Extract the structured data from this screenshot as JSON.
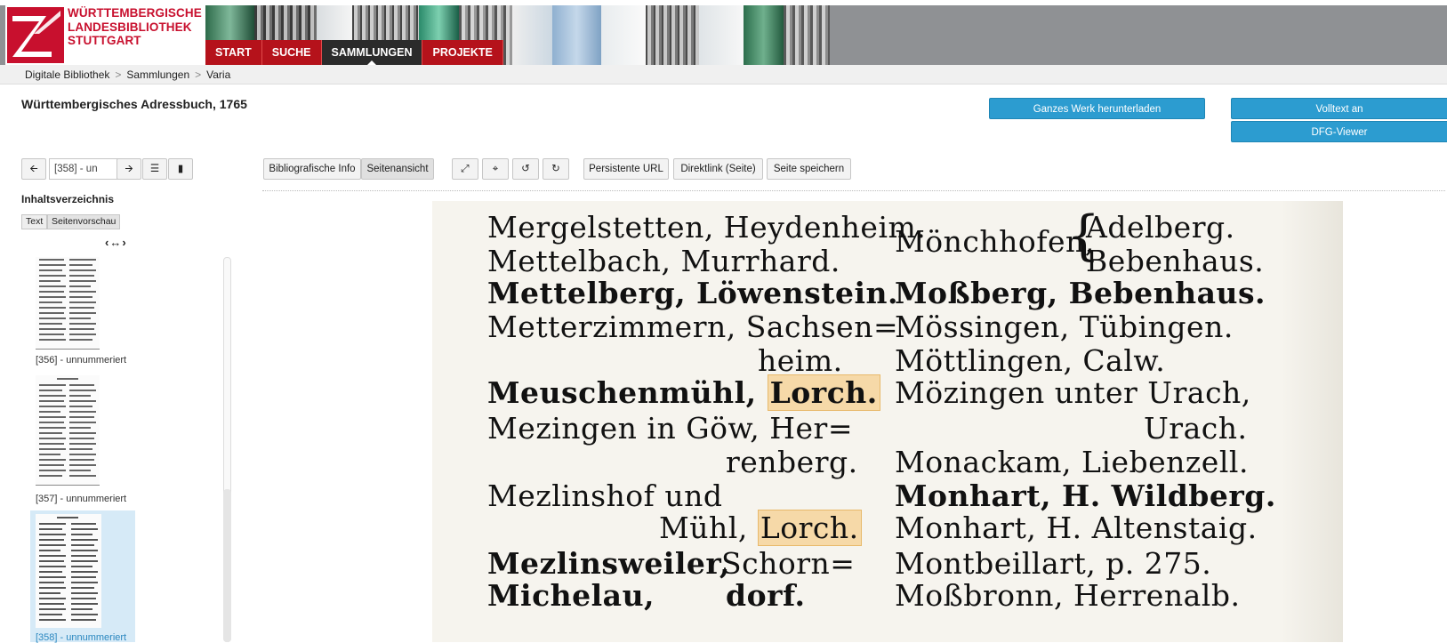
{
  "logo": {
    "line1": "WÜRTTEMBERGISCHE",
    "line2": "LANDESBIBLIOTHEK",
    "line3": "STUTTGART"
  },
  "nav": [
    "START",
    "SUCHE",
    "SAMMLUNGEN",
    "PROJEKTE"
  ],
  "breadcrumb": [
    "Digitale Bibliothek",
    "Sammlungen",
    "Varia"
  ],
  "breadcrumb_sep": ">",
  "title": "Württembergisches Adressbuch, 1765",
  "actions": {
    "download": "Ganzes Werk herunterladen",
    "fulltext": "Volltext an",
    "dfg": "DFG-Viewer"
  },
  "pager": {
    "prev_icon": "arrow-left-icon",
    "page_value": "[358] - un",
    "next_icon": "arrow-right-icon",
    "list_icon": "list-icon",
    "book_icon": "book-icon"
  },
  "view_tabs": [
    "Bibliografische Info",
    "Seitenansicht"
  ],
  "view_tools": [
    "fullscreen-icon",
    "fit-icon",
    "rotate-left-icon",
    "rotate-right-icon"
  ],
  "links": [
    "Persistente URL",
    "Direktlink (Seite)",
    "Seite speichern"
  ],
  "toc": {
    "label": "Inhaltsverzeichnis",
    "tab_text": "Text",
    "tab_preview": "Seitenvorschau",
    "resize": "‹↔›",
    "items": [
      {
        "caption": "[356] - unnummeriert"
      },
      {
        "caption": "[357] - unnummeriert"
      },
      {
        "caption": "[358] - unnummeriert"
      }
    ]
  },
  "page_text": {
    "left": [
      "Mergelstetten, Heydenheim.",
      "Mettelbach, Murrhard.",
      "Mettelberg, Löwenstein.",
      "Metterzimmern, Sachsen=",
      "heim.",
      "Meuschenmühl, ",
      "Lorch.",
      "Mezingen in Göw, Her=",
      "renberg.",
      "Mezlinshof und",
      "Mühl, ",
      "Lorch.",
      "Mezlinsweiler,",
      "Schorn=",
      "Michelau,",
      "dorf."
    ],
    "right": [
      "Mönchhofen,",
      "Adelberg.",
      "Bebenhaus.",
      "Moßberg, Bebenhaus.",
      "Mössingen, Tübingen.",
      "Möttlingen, Calw.",
      "Mözingen unter Urach,",
      "Urach.",
      "Monackam, Liebenzell.",
      "Monhart, H. Wildberg.",
      "Monhart, H. Altenstaig.",
      "Montbeillart, p. 275.",
      "Moßbronn, Herrenalb."
    ]
  },
  "colors": {
    "brand_red": "#c8102e",
    "nav_red": "#b5121b",
    "button_blue": "#2c9cd0",
    "highlight": "#f6d9a8"
  }
}
